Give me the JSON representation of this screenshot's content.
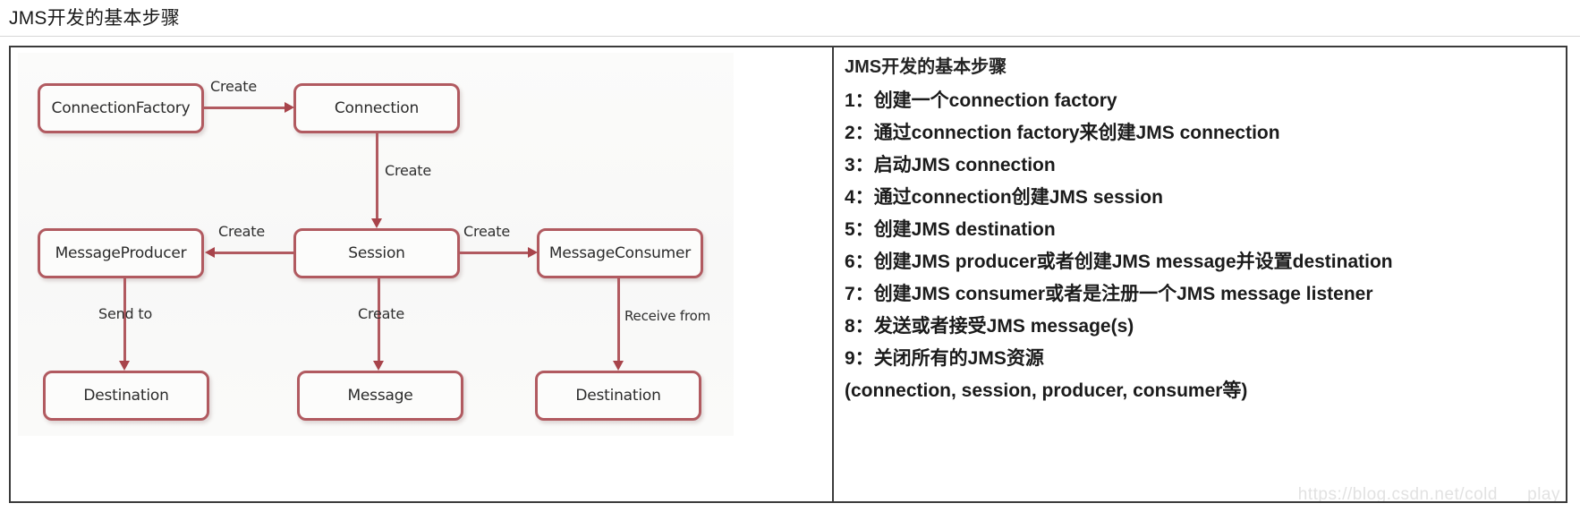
{
  "page": {
    "title": "JMS开发的基本步骤",
    "watermark": "https://blog.csdn.net/cold___play"
  },
  "diagram": {
    "nodes": [
      {
        "id": "connection-factory",
        "label": "ConnectionFactory"
      },
      {
        "id": "connection",
        "label": "Connection"
      },
      {
        "id": "message-producer",
        "label": "MessageProducer"
      },
      {
        "id": "session",
        "label": "Session"
      },
      {
        "id": "message-consumer",
        "label": "MessageConsumer"
      },
      {
        "id": "destination-left",
        "label": "Destination"
      },
      {
        "id": "message",
        "label": "Message"
      },
      {
        "id": "destination-right",
        "label": "Destination"
      }
    ],
    "edges": [
      {
        "id": "cf-to-connection",
        "from": "ConnectionFactory",
        "to": "Connection",
        "label": "Create"
      },
      {
        "id": "connection-to-session",
        "from": "Connection",
        "to": "Session",
        "label": "Create"
      },
      {
        "id": "session-to-producer",
        "from": "Session",
        "to": "MessageProducer",
        "label": "Create"
      },
      {
        "id": "session-to-consumer",
        "from": "Session",
        "to": "MessageConsumer",
        "label": "Create"
      },
      {
        "id": "producer-to-destination",
        "from": "MessageProducer",
        "to": "Destination",
        "label": "Send to"
      },
      {
        "id": "session-to-message",
        "from": "Session",
        "to": "Message",
        "label": "Create"
      },
      {
        "id": "consumer-to-destination",
        "from": "MessageConsumer",
        "to": "Destination",
        "label": "Receive from"
      }
    ],
    "colors": {
      "node_border": "#b15a60",
      "node_fill": "#fcfcfb",
      "arrow": "#a8444b",
      "canvas": "#fafaf9"
    }
  },
  "steps_panel": {
    "heading": "JMS开发的基本步骤",
    "items": [
      {
        "num": "1：",
        "text": "创建一个connection factory"
      },
      {
        "num": "2：",
        "text": "通过connection factory来创建JMS connection"
      },
      {
        "num": "3：",
        "text": "启动JMS connection"
      },
      {
        "num": "4：",
        "text": "通过connection创建JMS session"
      },
      {
        "num": "5：",
        "text": "创建JMS destination"
      },
      {
        "num": "6：",
        "text": "创建JMS producer或者创建JMS message并设置destination"
      },
      {
        "num": "7：",
        "text": "创建JMS consumer或者是注册一个JMS message listener"
      },
      {
        "num": "8：",
        "text": "发送或者接受JMS message(s)"
      },
      {
        "num": "9：",
        "text": "关闭所有的JMS资源"
      }
    ],
    "footer": "(connection, session, producer, consumer等)"
  }
}
